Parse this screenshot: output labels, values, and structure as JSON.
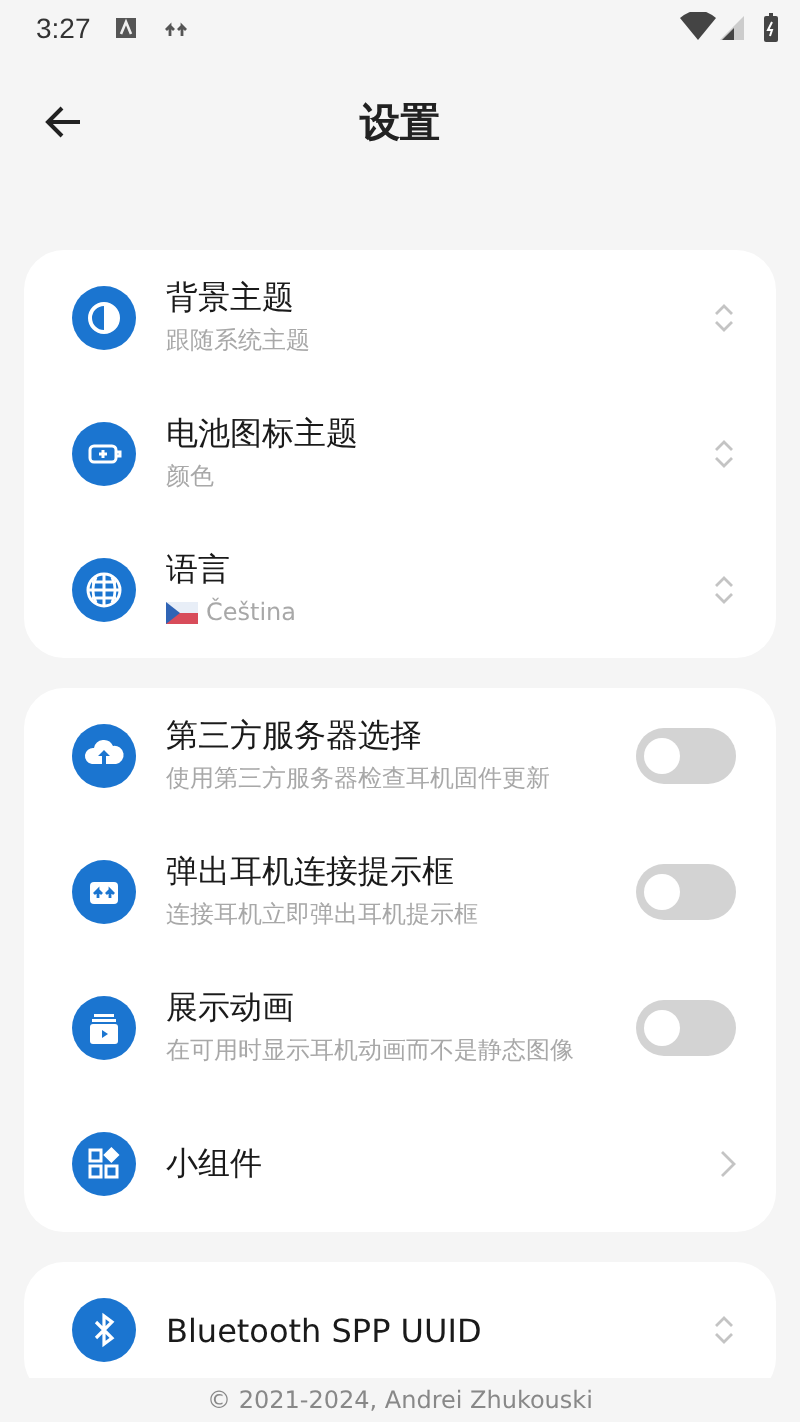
{
  "status_bar": {
    "time": "3:27"
  },
  "header": {
    "title": "设置"
  },
  "sections": [
    {
      "rows": [
        {
          "kind": "select",
          "title": "背景主题",
          "subtitle": "跟随系统主题"
        },
        {
          "kind": "select",
          "title": "电池图标主题",
          "subtitle": "颜色"
        },
        {
          "kind": "select",
          "title": "语言",
          "subtitle": "Čeština"
        }
      ]
    },
    {
      "rows": [
        {
          "kind": "toggle",
          "title": "第三方服务器选择",
          "subtitle": "使用第三方服务器检查耳机固件更新",
          "on": false
        },
        {
          "kind": "toggle",
          "title": "弹出耳机连接提示框",
          "subtitle": "连接耳机立即弹出耳机提示框",
          "on": false
        },
        {
          "kind": "toggle",
          "title": "展示动画",
          "subtitle": "在可用时显示耳机动画而不是静态图像",
          "on": false
        },
        {
          "kind": "link",
          "title": "小组件"
        }
      ]
    },
    {
      "rows": [
        {
          "kind": "select",
          "title": "Bluetooth SPP UUID"
        }
      ]
    }
  ],
  "footer": "© 2021-2024, Andrei Zhukouski"
}
